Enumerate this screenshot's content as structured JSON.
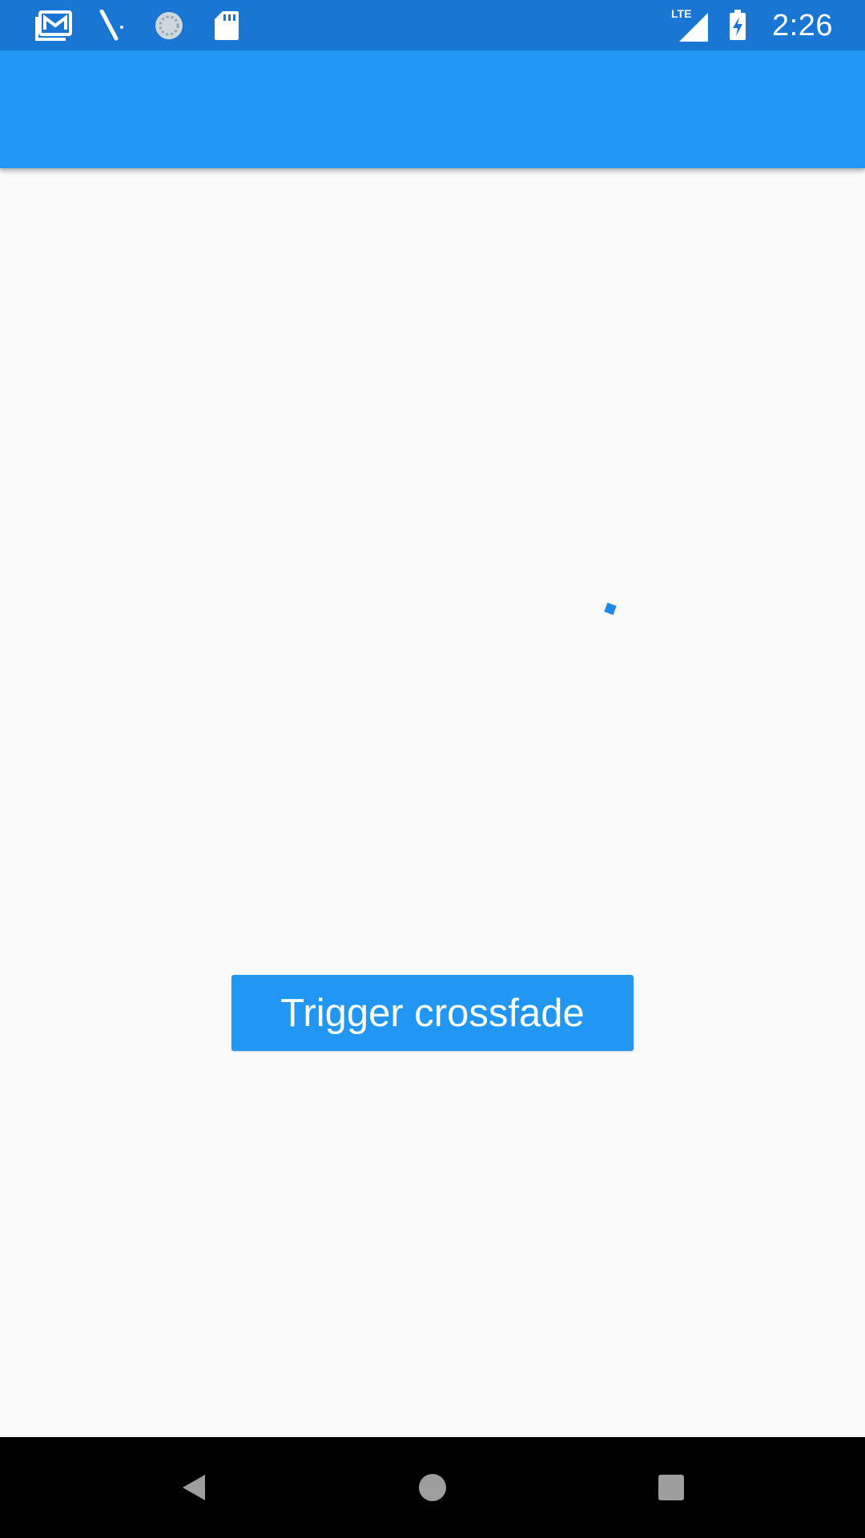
{
  "status_bar": {
    "time": "2:26",
    "network_label": "LTE",
    "left_icons": [
      "gmail-icon",
      "pen-icon",
      "sync-icon",
      "sd-card-icon"
    ],
    "right_icons": [
      "signal-icon",
      "battery-charging-icon"
    ],
    "background": "#1976d2"
  },
  "app_bar": {
    "title": "",
    "background": "#2196f3"
  },
  "main": {
    "trigger_button_label": "Trigger crossfade",
    "accent": "#2196f3"
  },
  "nav_bar": {
    "buttons": [
      "back-icon",
      "home-icon",
      "recents-icon"
    ]
  }
}
